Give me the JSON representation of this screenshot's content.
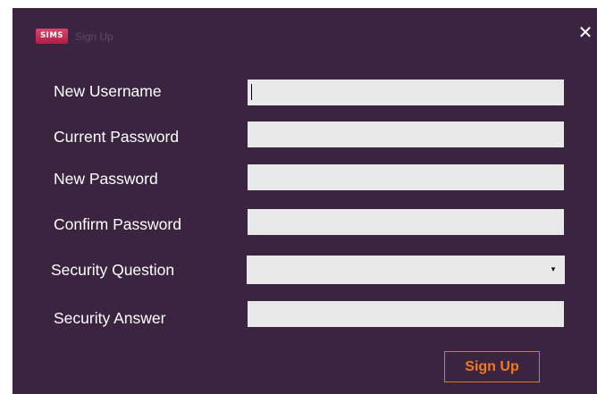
{
  "window": {
    "logo_text": "SIMS",
    "title": "Sign Up",
    "close_glyph": "✕",
    "colors": {
      "background": "#3a2440",
      "field": "#e9e9e9",
      "accent": "#f07a20",
      "logo": "#c8244f"
    }
  },
  "form": {
    "labels": {
      "new_username": "New Username",
      "current_password": "Current Password",
      "new_password": "New Password",
      "confirm_password": "Confirm Password",
      "security_question": "Security Question",
      "security_answer": "Security Answer"
    },
    "values": {
      "new_username": "",
      "current_password": "",
      "new_password": "",
      "confirm_password": "",
      "security_question": "",
      "security_answer": ""
    },
    "dropdown_arrow": "▾",
    "submit_label": "Sign Up"
  }
}
